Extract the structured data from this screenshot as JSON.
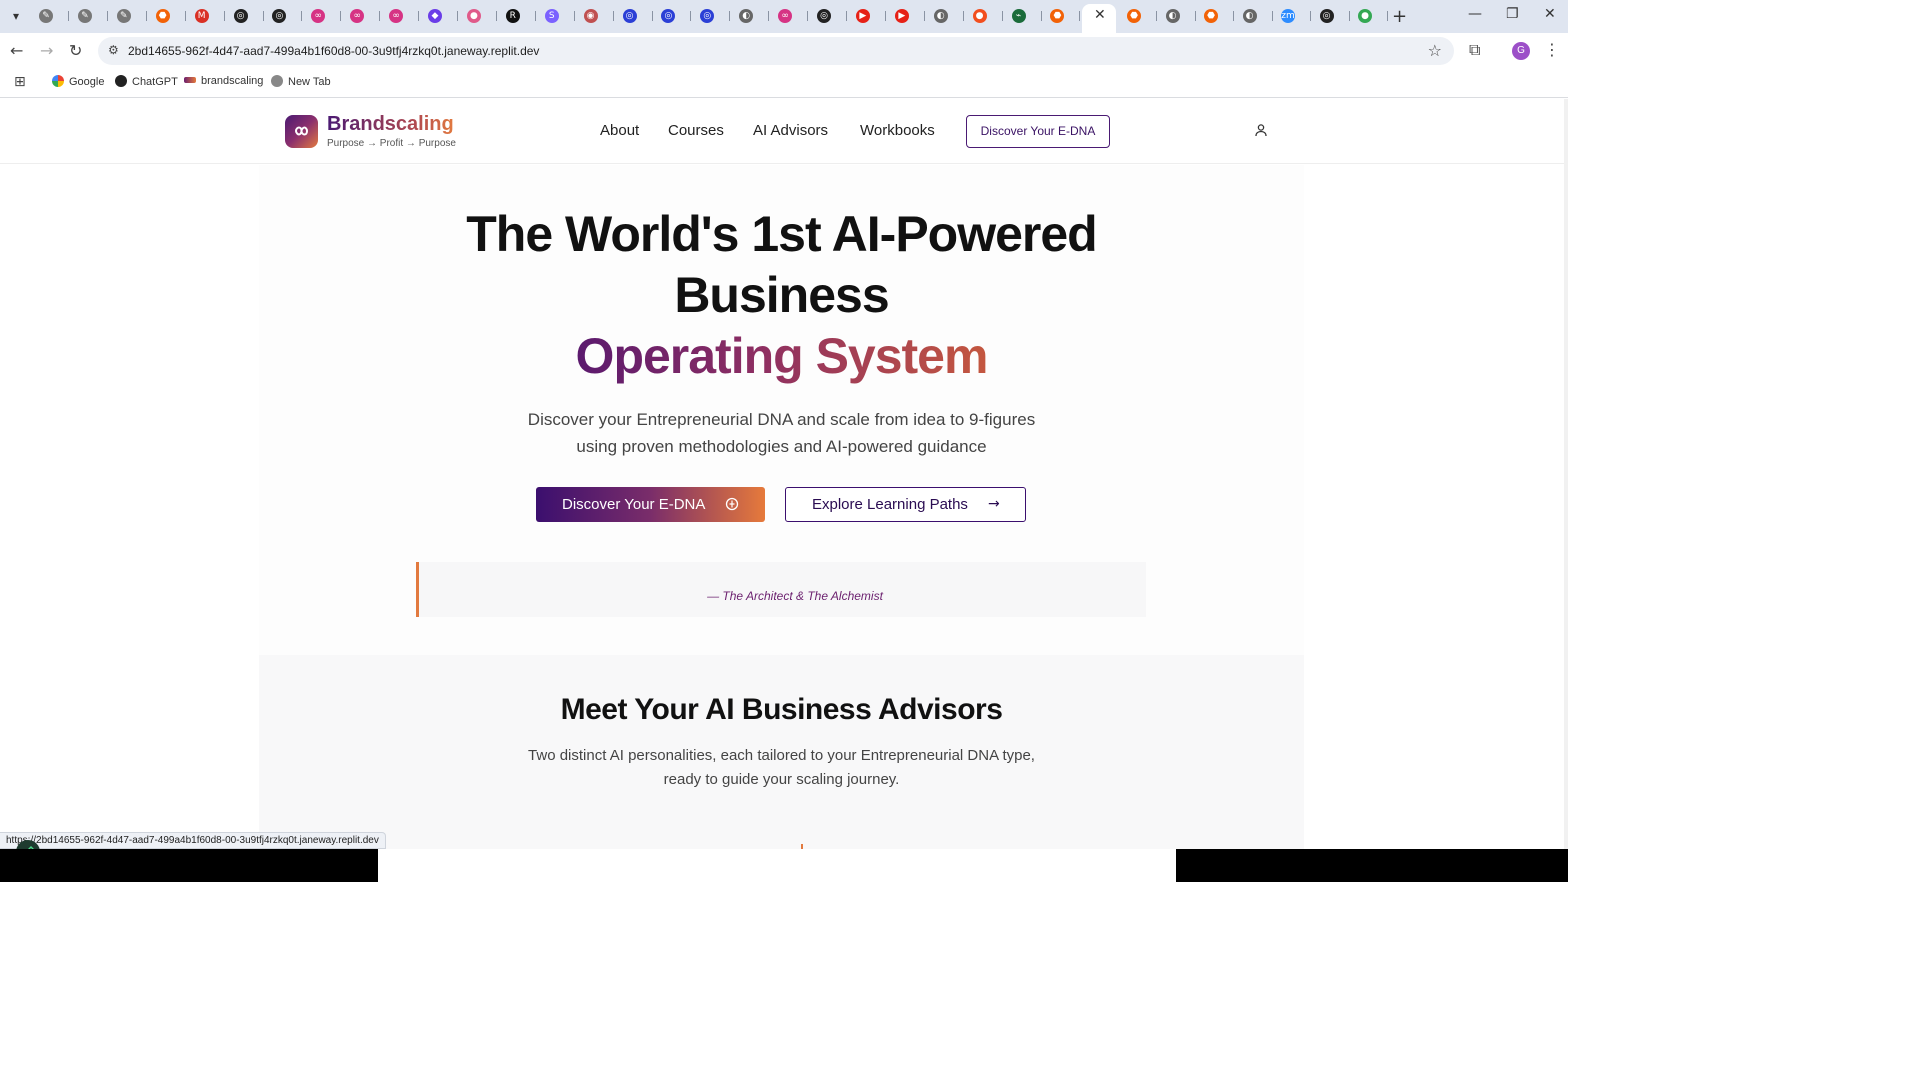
{
  "browser": {
    "tabs": [
      {
        "icon": "claude-icon",
        "color": "#777777",
        "glyph": "✎"
      },
      {
        "icon": "claude-icon",
        "color": "#777777",
        "glyph": "✎"
      },
      {
        "icon": "claude-icon",
        "color": "#777777",
        "glyph": "✎"
      },
      {
        "icon": "replit-icon",
        "color": "#f26207",
        "glyph": "⬣"
      },
      {
        "icon": "gmail-icon",
        "color": "#d93025",
        "glyph": "M"
      },
      {
        "icon": "openai-icon",
        "color": "#222222",
        "glyph": "◎"
      },
      {
        "icon": "openai-icon",
        "color": "#222222",
        "glyph": "◎"
      },
      {
        "icon": "make-icon",
        "color": "#d63384",
        "glyph": "∞"
      },
      {
        "icon": "make-icon",
        "color": "#d63384",
        "glyph": "∞"
      },
      {
        "icon": "make-icon",
        "color": "#d63384",
        "glyph": "∞"
      },
      {
        "icon": "app-icon",
        "color": "#6a3de8",
        "glyph": "◆"
      },
      {
        "icon": "app-icon",
        "color": "#e05a8a",
        "glyph": "●"
      },
      {
        "icon": "r-icon",
        "color": "#111111",
        "glyph": "R"
      },
      {
        "icon": "s-icon",
        "color": "#7b61ff",
        "glyph": "S"
      },
      {
        "icon": "app-icon",
        "color": "#c05050",
        "glyph": "◉"
      },
      {
        "icon": "app-icon",
        "color": "#2b3fd6",
        "glyph": "◎"
      },
      {
        "icon": "app-icon",
        "color": "#2b3fd6",
        "glyph": "◎"
      },
      {
        "icon": "app-icon",
        "color": "#2b3fd6",
        "glyph": "◎"
      },
      {
        "icon": "globe-icon",
        "color": "#666666",
        "glyph": "◐"
      },
      {
        "icon": "make-icon",
        "color": "#d63384",
        "glyph": "∞"
      },
      {
        "icon": "openai-icon",
        "color": "#222222",
        "glyph": "◎"
      },
      {
        "icon": "youtube-icon",
        "color": "#e62117",
        "glyph": "▶"
      },
      {
        "icon": "youtube-icon",
        "color": "#e62117",
        "glyph": "▶"
      },
      {
        "icon": "globe-icon",
        "color": "#666666",
        "glyph": "◐"
      },
      {
        "icon": "app-icon",
        "color": "#f24e1e",
        "glyph": "●"
      },
      {
        "icon": "chart-icon",
        "color": "#1a6b3a",
        "glyph": "⌁"
      },
      {
        "icon": "replit-icon",
        "color": "#f26207",
        "glyph": "⬣"
      }
    ],
    "tabs_after": [
      {
        "icon": "replit-icon",
        "color": "#f26207",
        "glyph": "⬣"
      },
      {
        "icon": "globe-icon",
        "color": "#666666",
        "glyph": "◐"
      },
      {
        "icon": "replit-icon",
        "color": "#f26207",
        "glyph": "⬣"
      },
      {
        "icon": "globe-icon",
        "color": "#666666",
        "glyph": "◐"
      },
      {
        "icon": "zoom-icon",
        "color": "#2d8cff",
        "glyph": "zm"
      },
      {
        "icon": "openai-icon",
        "color": "#222222",
        "glyph": "◎"
      },
      {
        "icon": "app-icon",
        "color": "#34a853",
        "glyph": "●"
      }
    ],
    "url": "2bd14655-962f-4d47-aad7-499a4b1f60d8-00-3u9tfj4rzkq0t.janeway.replit.dev",
    "profile_initial": "G",
    "bookmarks": [
      "Google",
      "ChatGPT",
      "brandscaling",
      "New Tab"
    ],
    "status_url": "https://2bd14655-962f-4d47-aad7-499a4b1f60d8-00-3u9tfj4rzkq0t.janeway.replit.dev"
  },
  "site": {
    "brand_name": "Brandscaling",
    "brand_tagline": "Purpose → Profit → Purpose",
    "nav": [
      "About",
      "Courses",
      "AI Advisors",
      "Workbooks"
    ],
    "header_cta": "Discover Your E-DNA"
  },
  "hero": {
    "title_line1": "The World's 1st AI-Powered",
    "title_line2": "Business",
    "title_line3": "Operating System",
    "subtitle_line1": "Discover your Entrepreneurial DNA and scale from idea to 9-figures",
    "subtitle_line2": "using proven methodologies and AI-powered guidance",
    "primary_cta": "Discover Your E-DNA",
    "secondary_cta": "Explore Learning Paths",
    "quote_attribution": "— The Architect & The Alchemist"
  },
  "advisors": {
    "title": "Meet Your AI Business Advisors",
    "subtitle_line1": "Two distinct AI personalities, each tailored to your Entrepreneurial DNA type,",
    "subtitle_line2": "ready to guide your scaling journey."
  },
  "colors": {
    "brand_purple": "#3b0f6e",
    "brand_orange": "#e67a3b",
    "accent_magenta": "#6b1f6e"
  }
}
